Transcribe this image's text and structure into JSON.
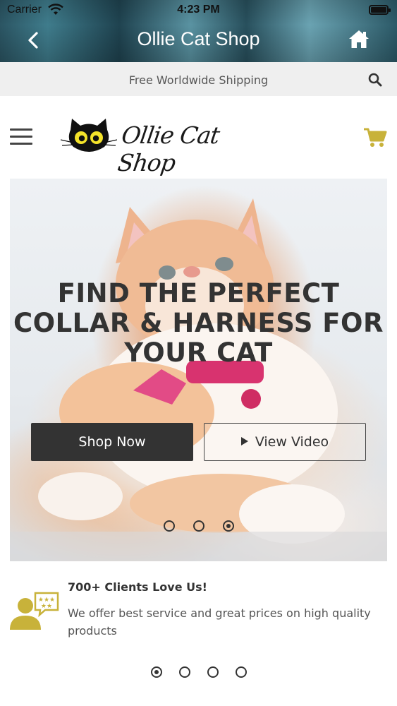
{
  "status": {
    "carrier": "Carrier",
    "time": "4:23 PM"
  },
  "nav": {
    "title": "Ollie Cat Shop"
  },
  "shipping": {
    "text": "Free Worldwide Shipping"
  },
  "header": {
    "logo_text": "Ollie Cat Shop"
  },
  "hero": {
    "title_lines": [
      "FIND THE PERFECT",
      "COLLAR & HARNESS FOR",
      "YOUR CAT"
    ],
    "shop_label": "Shop Now",
    "video_label": "View Video",
    "slide_count": 3,
    "active_slide": 3
  },
  "feature": {
    "title": "700+ Clients Love Us!",
    "text": "We offer best service and great prices on high quality products"
  },
  "carousel2": {
    "slide_count": 4,
    "active_slide": 1
  },
  "colors": {
    "accent": "#c8b23a",
    "dark_button": "#333333",
    "shipping_bar": "#efefef"
  },
  "icons": [
    "wifi-icon",
    "battery-icon",
    "back-icon",
    "home-icon",
    "search-icon",
    "menu-icon",
    "cat-logo-icon",
    "cart-icon",
    "play-icon",
    "client-review-icon"
  ]
}
